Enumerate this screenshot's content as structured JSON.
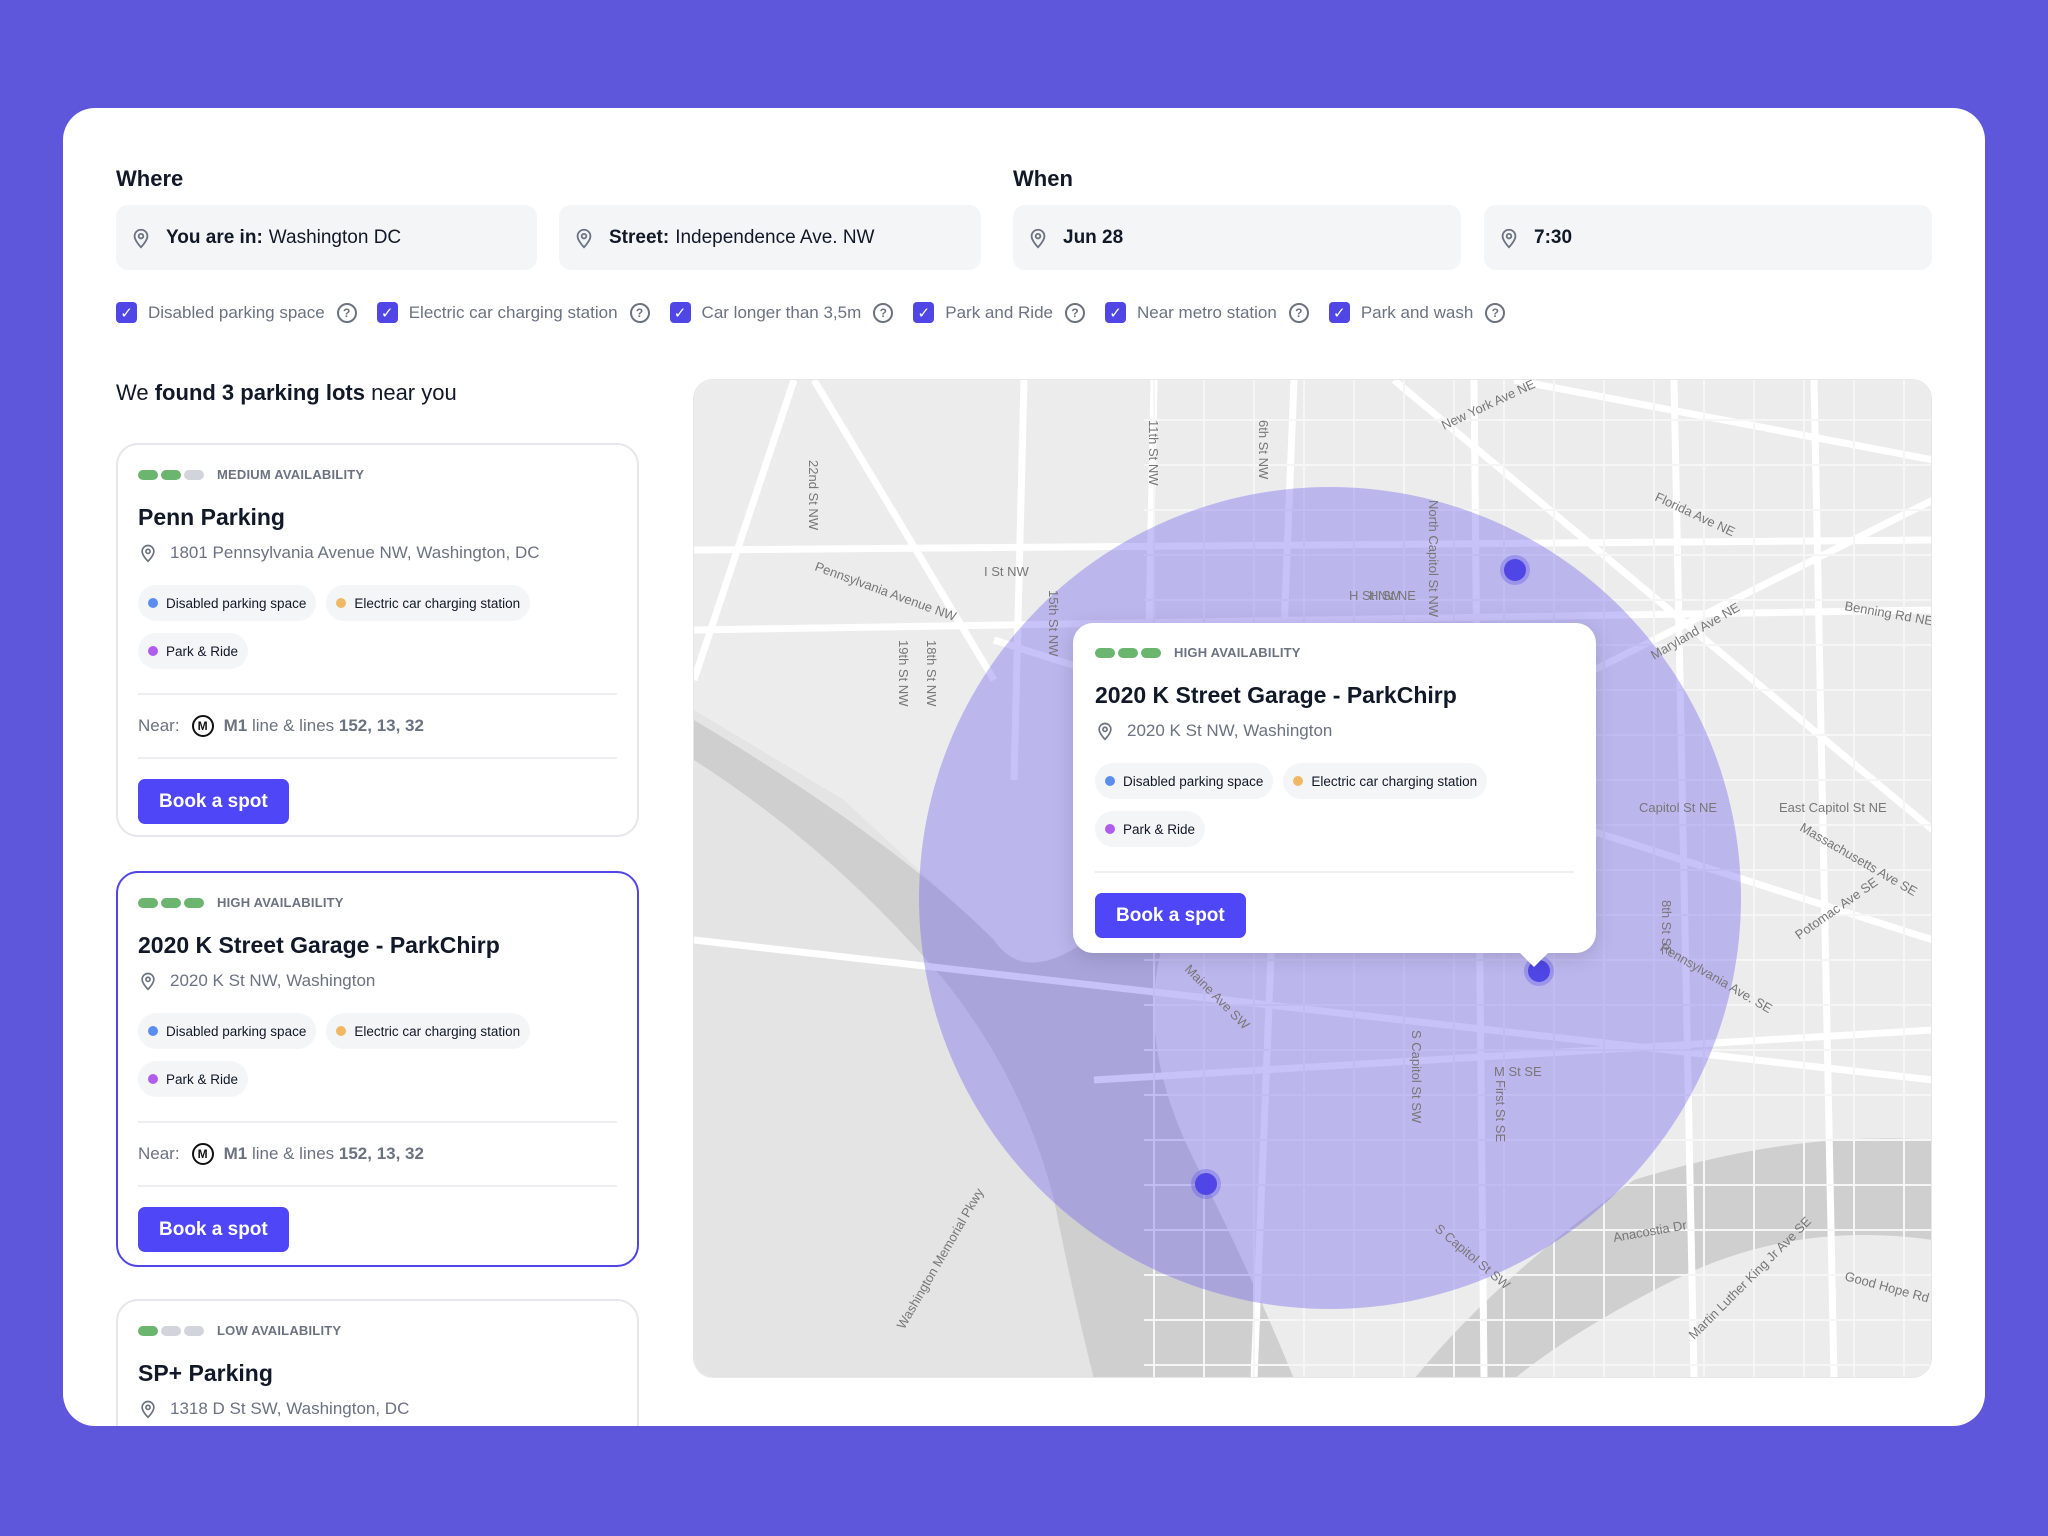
{
  "where": {
    "label": "Where",
    "location": {
      "prefix": "You are in:",
      "value": "Washington DC"
    },
    "street": {
      "prefix": "Street:",
      "value": "Independence Ave. NW"
    }
  },
  "when": {
    "label": "When",
    "date": "Jun 28",
    "time": "7:30"
  },
  "filters": [
    {
      "label": "Disabled parking space",
      "checked": true
    },
    {
      "label": "Electric car charging station",
      "checked": true
    },
    {
      "label": "Car longer than 3,5m",
      "checked": true
    },
    {
      "label": "Park and Ride",
      "checked": true
    },
    {
      "label": "Near metro station",
      "checked": true
    },
    {
      "label": "Park and wash",
      "checked": true
    }
  ],
  "results": {
    "prefix": "We",
    "bold": "found 3 parking lots",
    "suffix": "near you"
  },
  "tag_colors": {
    "disabled": "#5b8def",
    "electric": "#f0b865",
    "park_ride": "#b05cec"
  },
  "lots": [
    {
      "availability": "MEDIUM AVAILABILITY",
      "level": 2,
      "name": "Penn Parking",
      "address": "1801 Pennsylvania Avenue NW, Washington, DC",
      "tags": [
        "Disabled parking space",
        "Electric car charging station",
        "Park & Ride"
      ],
      "near_label": "Near:",
      "metro_icon": "M",
      "near_line": "M1",
      "near_mid": "line & lines",
      "near_lines": "152, 13, 32",
      "button": "Book a spot"
    },
    {
      "availability": "HIGH AVAILABILITY",
      "level": 3,
      "name": "2020 K Street Garage - ParkChirp",
      "address": "2020 K St NW, Washington",
      "tags": [
        "Disabled parking space",
        "Electric car charging station",
        "Park & Ride"
      ],
      "near_label": "Near:",
      "metro_icon": "M",
      "near_line": "M1",
      "near_mid": "line & lines",
      "near_lines": "152, 13, 32",
      "button": "Book a spot",
      "selected": true
    },
    {
      "availability": "LOW AVAILABILITY",
      "level": 1,
      "name": "SP+ Parking",
      "address": "1318 D St SW, Washington, DC"
    }
  ],
  "map": {
    "accent": "#4f46e5",
    "labels": [
      "New York Ave NE",
      "Pennsylvania Avenue NW",
      "I St NW",
      "H St NE",
      "H St NW",
      "Florida Ave NE",
      "Maryland Ave NE",
      "Capitol St NE",
      "East Capitol St NE",
      "Massachusetts Ave SE",
      "Pennsylvania Ave. SE",
      "Potomac Ave SE",
      "M St SE",
      "Maine Ave SW",
      "S Capitol St SW",
      "Anacostia Dr",
      "Good Hope Rd",
      "Benning Rd NE",
      "11th St NW",
      "6th St NW",
      "22nd St NW",
      "19th St NW",
      "18th St NW",
      "15th St NW",
      "North Capitol St NW",
      "8th St SE",
      "First St SE",
      "S Capitol St SW",
      "Washington Memorial Pkwy",
      "Martin Luther King Jr Ave SE"
    ],
    "popup": {
      "availability": "HIGH AVAILABILITY",
      "level": 3,
      "name": "2020 K Street Garage - ParkChirp",
      "address": "2020 K St NW, Washington",
      "tags": [
        "Disabled parking space",
        "Electric car charging station",
        "Park & Ride"
      ],
      "button": "Book a spot"
    }
  }
}
